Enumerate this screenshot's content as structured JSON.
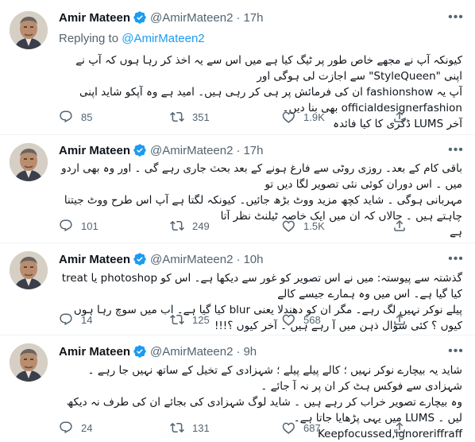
{
  "tweets": [
    {
      "name": "Amir Mateen",
      "handle": "@AmirMateen2",
      "time": "17h",
      "replying_prefix": "Replying to ",
      "replying_handle": "@AmirMateen2",
      "lines": [
        "کیونکہ آپ نے مجھے خاص طور پر ٹیگ کیا ہے میں اس سے یہ اخذ کر رہا ہوں کہ آپ نے اپنی \"StyleQueen\" سے اجازت لی ہوگی اور",
        "آپ یہ fashionshow ان کی فرمائش پر ہی کر رہی ہیں۔ امید ہے وہ آپکو شاید اپنی officialdesignerfashion بھی بنا دیں۔",
        "آخر LUMS ڈگری کا کیا فائدہ"
      ],
      "replies": "85",
      "retweets": "351",
      "likes": "1.9K"
    },
    {
      "name": "Amir Mateen",
      "handle": "@AmirMateen2",
      "time": "17h",
      "lines": [
        "باقی کام کے بعد۔ روزی روٹی سے فارغ ہونے کے بعد بحث جاری رہے گی ۔ اور وہ بھی اردو میں ۔ اس دوران کوئی نئی تصویر لگا دیں تو",
        "مہربانی ہوگی ۔ شاید کچھ مزید ووٹ بڑھ جائیں۔ کیونکہ لگتا ہے آپ اس طرح ووٹ جیتنا چاہتے ہیں ۔ حالاں کہ ان میں ایک خاصہ ٹیلنٹ نظر آتا",
        "ہے"
      ],
      "replies": "101",
      "retweets": "249",
      "likes": "1.5K"
    },
    {
      "name": "Amir Mateen",
      "handle": "@AmirMateen2",
      "time": "10h",
      "lines": [
        "گذشتہ سے پیوستہ: میں نے اس تصویر کو غور سے دیکھا ہے۔ اس کو photoshop یا treat کیا گیا ہے۔ اس میں وہ ہمارے جیسے کالے",
        "پیلے نوکر نہیں لگ رہے۔ مگر ان کو دھندلا یعنی blur کیا گیا ہے۔ اب میں سوچ رہا ہوں کیوں ؟ کئی سوال ذہن میں آ رہے ہیں ۔ آخر کیوں ؟!!!"
      ],
      "replies": "14",
      "retweets": "125",
      "likes": "568"
    },
    {
      "name": "Amir Mateen",
      "handle": "@AmirMateen2",
      "time": "9h",
      "lines": [
        "شاید یہ بیچارے نوکر نہیں ؛ کالے پیلے پیلے ؛ شہزادی کے تخیل کے ساتھ نہیں جا رہے ۔ شہزادی سے فوکس ہٹ کر ان پر نہ آ جائے ۔",
        "وہ بیچارے تصویر خراب کر رہے ہیں ۔ شاید لوگ شہزادی کی بجائے ان کی طرف نہ دیکھ لیں ۔ LUMS میں یہی پڑھایا جاتا ہے۔",
        "Keepfocussed,ignoreriffraff"
      ],
      "replies": "24",
      "retweets": "131",
      "likes": "687"
    }
  ]
}
